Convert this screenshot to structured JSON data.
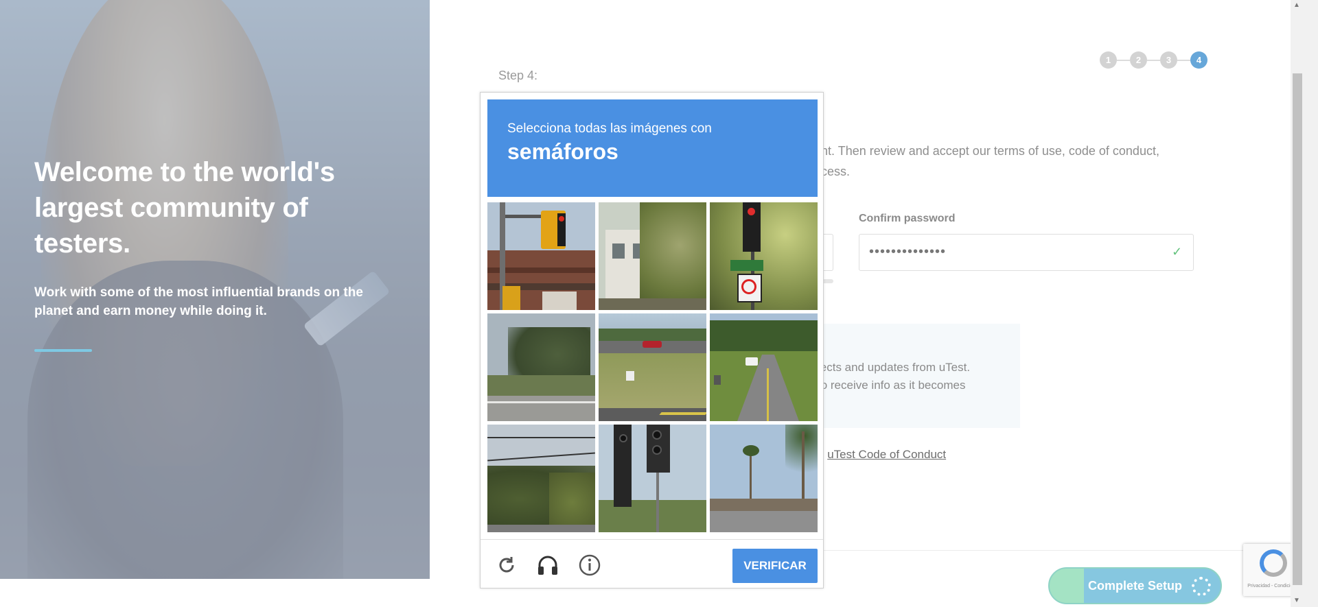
{
  "hero": {
    "title": "Welcome to the world's largest community of testers.",
    "subtitle": "Work with some of the most influential brands on the planet and earn money while doing it."
  },
  "form": {
    "step_label": "Step 4:",
    "steps": [
      "1",
      "2",
      "3",
      "4"
    ],
    "active_step": "4",
    "intro_line1": "unt. Then review and accept our terms of use, code of conduct,",
    "intro_line2": "ocess.",
    "confirm_password_label": "Confirm password",
    "confirm_password_value": "••••••••••••••",
    "info_line1": "jects and updates from uTest.",
    "info_line2": "to receive info as it becomes",
    "coc_prefix": "e ",
    "coc_link": "uTest Code of Conduct",
    "complete_button": "Complete Setup"
  },
  "captcha": {
    "instruction": "Selecciona todas las imágenes con",
    "target": "semáforos",
    "verify_button": "VERIFICAR",
    "tiles": [
      {
        "scene": "traffic-light-storefront"
      },
      {
        "scene": "house-tree"
      },
      {
        "scene": "red-light-no-right-turn"
      },
      {
        "scene": "palm-roadside"
      },
      {
        "scene": "highway-red-car"
      },
      {
        "scene": "road-white-car"
      },
      {
        "scene": "power-lines-trees"
      },
      {
        "scene": "traffic-signals"
      },
      {
        "scene": "palm-street"
      }
    ]
  },
  "recaptcha_badge": {
    "footer": "Privacidad - Condiciones"
  },
  "colors": {
    "captcha_blue": "#4a90e2",
    "step_active": "#67a7d9",
    "check_green": "#63c27d"
  }
}
